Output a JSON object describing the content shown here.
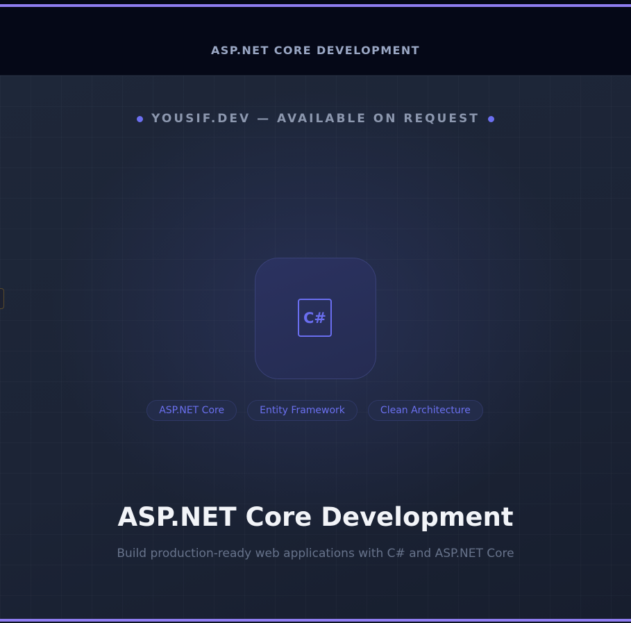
{
  "header": {
    "title": "ASP.NET CORE DEVELOPMENT"
  },
  "hero": {
    "availability": "YOUSIF.DEV — AVAILABLE ON REQUEST",
    "logo": {
      "text": "C#",
      "icon": "csharp-icon"
    },
    "tags": [
      {
        "label": "ASP.NET Core"
      },
      {
        "label": "Entity Framework"
      },
      {
        "label": "Clean Architecture"
      }
    ],
    "title": "ASP.NET Core Development",
    "subtitle": "Build production-ready web applications with C# and ASP.NET Core"
  },
  "colors": {
    "accent": "#8e7cf0",
    "indigo": "#6a6ef0",
    "header_bg": "#050817",
    "hero_bg": "#1c2436"
  }
}
